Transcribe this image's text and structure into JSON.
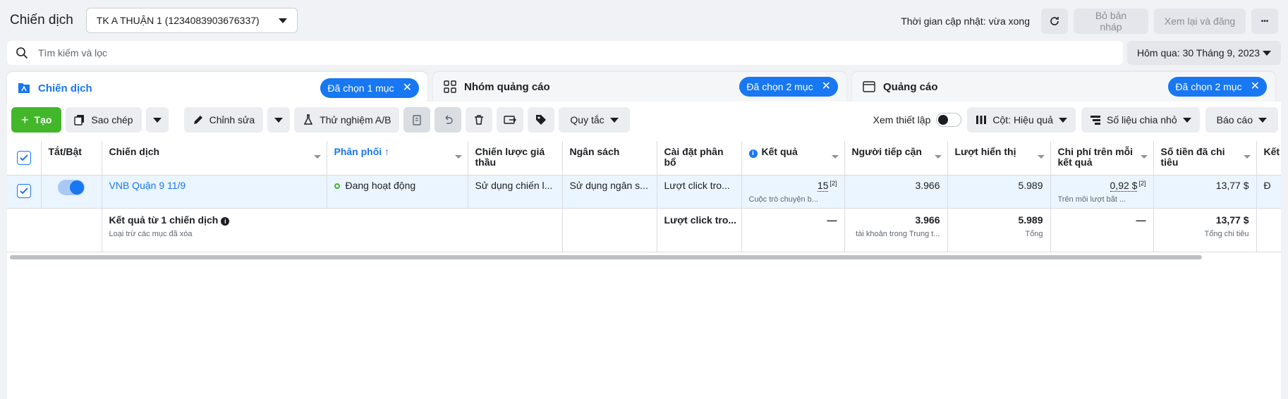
{
  "header": {
    "title": "Chiến dịch",
    "account": "TK A THUẬN 1 (1234083903676337)",
    "update_status": "Thời gian cập nhật: vừa xong",
    "discard_draft": "Bỏ bản nháp",
    "review_publish": "Xem lại và đăng",
    "more": "•••"
  },
  "search": {
    "placeholder": "Tìm kiếm và lọc",
    "date_range": "Hôm qua: 30 Tháng 9, 2023"
  },
  "tabs": [
    {
      "label": "Chiến dịch",
      "selected": "Đã chọn 1 mục"
    },
    {
      "label": "Nhóm quảng cáo",
      "selected": "Đã chọn 2 mục"
    },
    {
      "label": "Quảng cáo",
      "selected": "Đã chọn 2 mục"
    }
  ],
  "toolbar": {
    "create": "Tạo",
    "duplicate": "Sao chép",
    "edit": "Chỉnh sửa",
    "ab_test": "Thử nghiệm A/B",
    "rules": "Quy tắc",
    "view_setup": "Xem thiết lập",
    "columns": "Cột: Hiệu quả",
    "breakdown": "Số liệu chia nhỏ",
    "reports": "Báo cáo"
  },
  "table": {
    "headers": {
      "toggle": "Tắt/Bật",
      "campaign": "Chiến dịch",
      "delivery": "Phân phối ↑",
      "bid_strategy": "Chiến lược giá thầu",
      "budget": "Ngân sách",
      "attribution": "Cài đặt phân bổ",
      "results": "Kết quả",
      "reach": "Người tiếp cận",
      "impressions": "Lượt hiển thị",
      "cost_per_result": "Chi phí trên mỗi kết quả",
      "amount_spent": "Số tiền đã chi tiêu",
      "ends": "Kết"
    },
    "row": {
      "campaign": "VNB Quận 9 11/9",
      "delivery": "Đang hoạt động",
      "bid_strategy": "Sử dụng chiến l...",
      "budget": "Sử dụng ngân s...",
      "attribution": "Lượt click tro...",
      "results": "15",
      "results_sup": "[2]",
      "results_sub": "Cuộc trò chuyện b...",
      "reach": "3.966",
      "impressions": "5.989",
      "cost_per_result": "0,92 $",
      "cost_sup": "[2]",
      "cost_sub": "Trên mỗi lượt bắt ...",
      "amount_spent": "13,77 $",
      "ends": "Đ"
    },
    "summary": {
      "title": "Kết quả từ 1 chiến dịch",
      "subtitle": "Loại trừ các mục đã xóa",
      "attribution": "Lượt click tro...",
      "results": "—",
      "reach": "3.966",
      "reach_sub": "tài khoản trong Trung t...",
      "impressions": "5.989",
      "impressions_sub": "Tổng",
      "cost_per_result": "—",
      "amount_spent": "13,77 $",
      "amount_sub": "Tổng chi tiêu"
    }
  }
}
